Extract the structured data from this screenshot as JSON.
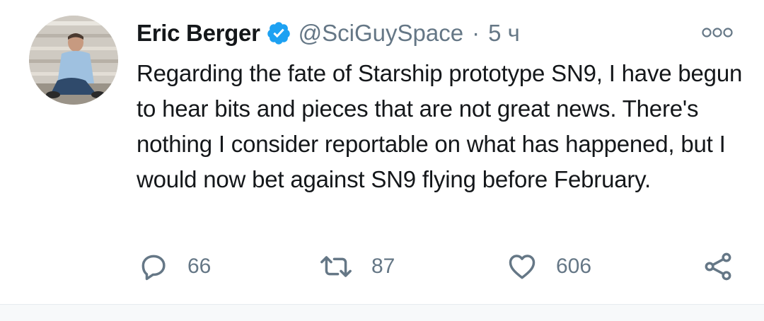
{
  "tweet": {
    "author": {
      "display_name": "Eric Berger",
      "handle": "@SciGuySpace",
      "verified": true,
      "avatar": "person-photo"
    },
    "separator": "·",
    "timestamp": "5 ч",
    "text": "Regarding the fate of Starship prototype SN9, I have begun to hear bits and pieces that are not great news. There's nothing I consider reportable on what has happened, but I would now bet against SN9 flying before February.",
    "actions": {
      "reply_count": "66",
      "retweet_count": "87",
      "like_count": "606"
    },
    "icons": {
      "more": "more-options-icon",
      "reply": "reply-icon",
      "retweet": "retweet-icon",
      "like": "heart-icon",
      "share": "share-icon",
      "verified": "verified-badge-icon"
    },
    "colors": {
      "text": "#14171a",
      "secondary": "#657786",
      "verified_blue": "#1da1f2"
    }
  }
}
